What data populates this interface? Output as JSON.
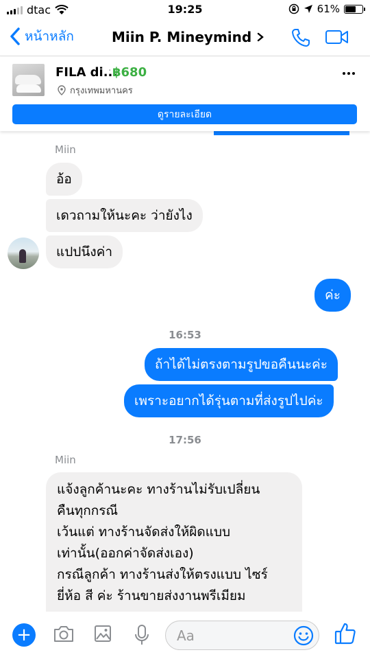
{
  "status_bar": {
    "carrier": "dtac",
    "time": "19:25",
    "battery": "61%"
  },
  "header": {
    "back_label": "หน้าหลัก",
    "contact_name": "Miin P. Mineymind"
  },
  "product": {
    "name": "FILA di...",
    "separator": "·",
    "price": "฿680",
    "location": "กรุงเทพมหานคร",
    "details_button": "ดูรายละเอียด"
  },
  "chat": {
    "sender_1": "Miin",
    "msg_1": "อ้อ",
    "msg_2": "เดวถามให้นะคะ ว่ายังไง",
    "msg_3": "แปปนึงค่า",
    "msg_4": "ค่ะ",
    "time_1": "16:53",
    "msg_5": "ถ้าได้ไม่ตรงตามรูปขอคืนนะค่ะ",
    "msg_6": "เพราะอยากได้รุ่นตามที่ส่งรูปไปค่ะ",
    "time_2": "17:56",
    "sender_2": "Miin",
    "msg_7_lines": [
      "แจ้งลูกค้านะคะ ทางร้านไม่รับเปลี่ยน",
      "คืนทุกกรณี",
      "เว้นแต่ ทางร้านจัดส่งให้ผิดแบบ",
      "เท่านั้น(ออกค่าจัดส่งเอง)",
      "กรณีลูกค้า ทางร้านส่งให้ตรงแบบ ไซร์",
      "ยี่ห้อ สี ค่ะ ร้านขายส่งงานพรีเมียม"
    ]
  },
  "composer": {
    "plus_label": "+",
    "placeholder": "Aa"
  },
  "colors": {
    "accent": "#0a7cff",
    "price_green": "#3cb043",
    "incoming_bubble": "#f1f0f0"
  },
  "icons": [
    "signal-icon",
    "wifi-icon",
    "lock-rotation-icon",
    "location-arrow-icon",
    "battery-icon",
    "back-chevron-icon",
    "phone-icon",
    "video-icon",
    "location-pin-icon",
    "more-icon",
    "camera-icon",
    "image-icon",
    "microphone-icon",
    "emoji-icon",
    "thumbs-up-icon"
  ]
}
